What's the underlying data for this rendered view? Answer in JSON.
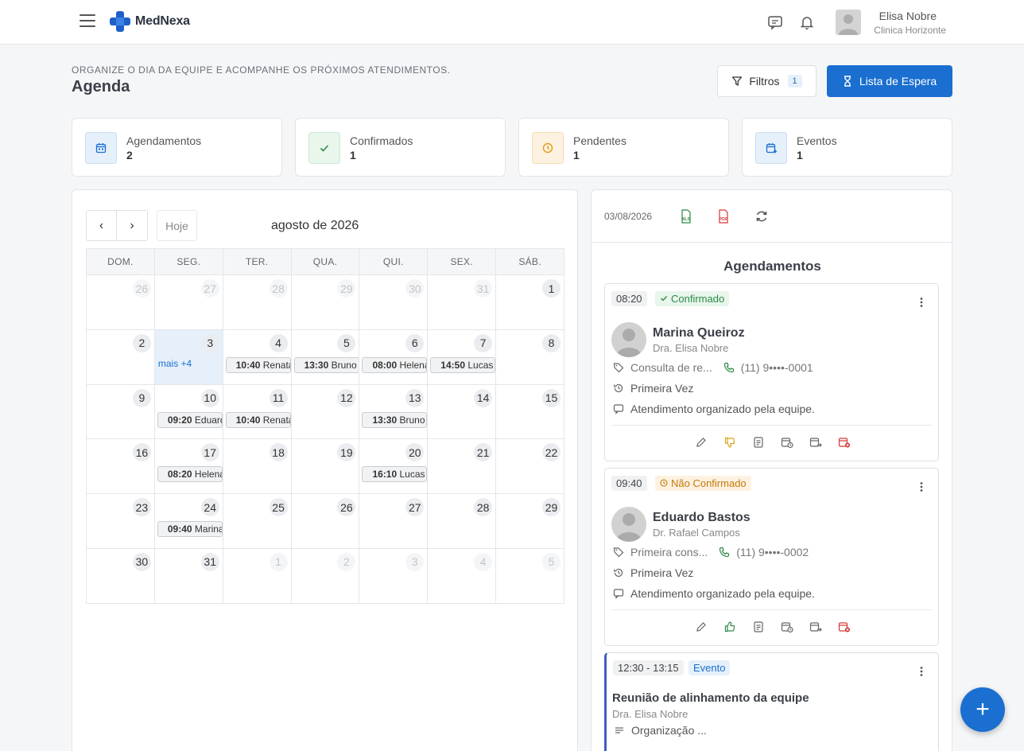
{
  "header": {
    "brand": "MedNexa",
    "user_name": "Elisa Nobre",
    "user_clinic": "Clinica Horizonte"
  },
  "page": {
    "subtitle": "ORGANIZE O DIA DA EQUIPE E ACOMPANHE OS PRÓXIMOS ATENDIMENTOS.",
    "title": "Agenda",
    "filters_label": "Filtros",
    "filters_count": "1",
    "waitlist_label": "Lista de Espera"
  },
  "stats": [
    {
      "label": "Agendamentos",
      "value": "2",
      "icon": "calendar-icon"
    },
    {
      "label": "Confirmados",
      "value": "1",
      "icon": "check-icon"
    },
    {
      "label": "Pendentes",
      "value": "1",
      "icon": "clock-icon"
    },
    {
      "label": "Eventos",
      "value": "1",
      "icon": "calendar-add-icon"
    }
  ],
  "calendar": {
    "prev": "‹",
    "next": "›",
    "today_label": "Hoje",
    "month_title": "agosto de 2026",
    "weekdays": [
      "DOM.",
      "SEG.",
      "TER.",
      "QUA.",
      "QUI.",
      "SEX.",
      "SÁB."
    ],
    "weeks": [
      [
        {
          "d": "26",
          "dim": true
        },
        {
          "d": "27",
          "dim": true
        },
        {
          "d": "28",
          "dim": true
        },
        {
          "d": "29",
          "dim": true
        },
        {
          "d": "30",
          "dim": true
        },
        {
          "d": "31",
          "dim": true
        },
        {
          "d": "1"
        }
      ],
      [
        {
          "d": "2"
        },
        {
          "d": "3",
          "today": true,
          "more": "mais +4"
        },
        {
          "d": "4",
          "evt_time": "10:40",
          "evt_name": "Renata"
        },
        {
          "d": "5",
          "evt_time": "13:30",
          "evt_name": "Bruno"
        },
        {
          "d": "6",
          "evt_time": "08:00",
          "evt_name": "Helena"
        },
        {
          "d": "7",
          "evt_time": "14:50",
          "evt_name": "Lucas"
        },
        {
          "d": "8"
        }
      ],
      [
        {
          "d": "9"
        },
        {
          "d": "10",
          "evt_time": "09:20",
          "evt_name": "Eduardo"
        },
        {
          "d": "11",
          "evt_time": "10:40",
          "evt_name": "Renata"
        },
        {
          "d": "12"
        },
        {
          "d": "13",
          "evt_time": "13:30",
          "evt_name": "Bruno"
        },
        {
          "d": "14"
        },
        {
          "d": "15"
        }
      ],
      [
        {
          "d": "16"
        },
        {
          "d": "17",
          "evt_time": "08:20",
          "evt_name": "Helena"
        },
        {
          "d": "18"
        },
        {
          "d": "19"
        },
        {
          "d": "20",
          "evt_time": "16:10",
          "evt_name": "Lucas"
        },
        {
          "d": "21"
        },
        {
          "d": "22"
        }
      ],
      [
        {
          "d": "23"
        },
        {
          "d": "24",
          "evt_time": "09:40",
          "evt_name": "Marina"
        },
        {
          "d": "25"
        },
        {
          "d": "26"
        },
        {
          "d": "27"
        },
        {
          "d": "28"
        },
        {
          "d": "29"
        }
      ],
      [
        {
          "d": "30"
        },
        {
          "d": "31"
        },
        {
          "d": "1",
          "dim": true
        },
        {
          "d": "2",
          "dim": true
        },
        {
          "d": "3",
          "dim": true
        },
        {
          "d": "4",
          "dim": true
        },
        {
          "d": "5",
          "dim": true
        }
      ]
    ]
  },
  "side": {
    "date": "03/08/2026",
    "title": "Agendamentos",
    "cards": [
      {
        "time": "08:20",
        "status": "Confirmado",
        "patient": "Marina Queiroz",
        "doctor": "Dra. Elisa Nobre",
        "service": "Consulta de re...",
        "phone": "(11) 9••••-0001",
        "visit_type": "Primeira Vez",
        "note": "Atendimento organizado pela equipe."
      },
      {
        "time": "09:40",
        "status": "Não Confirmado",
        "patient": "Eduardo Bastos",
        "doctor": "Dr. Rafael Campos",
        "service": "Primeira cons...",
        "phone": "(11) 9••••-0002",
        "visit_type": "Primeira Vez",
        "note": "Atendimento organizado pela equipe."
      }
    ],
    "event": {
      "time": "12:30 - 13:15",
      "tag": "Evento",
      "title": "Reunião de alinhamento da equipe",
      "doctor": "Dra. Elisa Nobre",
      "desc": "Organização ..."
    }
  },
  "colors": {
    "primary": "#1a6fd0",
    "confirmed": "#2e8a47",
    "pending": "#c47a0c",
    "danger": "#d93636"
  },
  "fab_label": "+"
}
